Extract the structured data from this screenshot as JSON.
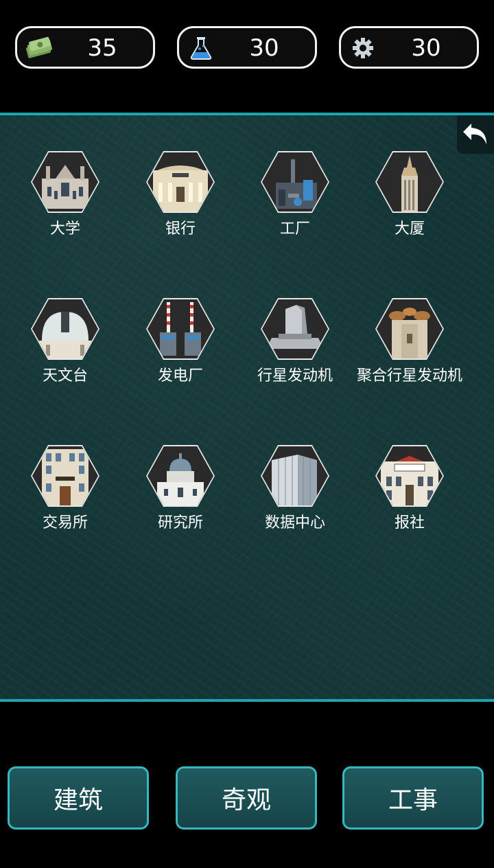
{
  "resources": {
    "money": {
      "icon": "cash-stack-icon",
      "value": "35"
    },
    "science": {
      "icon": "flask-icon",
      "value": "30"
    },
    "gear": {
      "icon": "gear-icon",
      "value": "30"
    }
  },
  "panel": {
    "back_icon": "undo-arrow-icon",
    "buildings": [
      {
        "id": "university",
        "label": "大学"
      },
      {
        "id": "bank",
        "label": "银行"
      },
      {
        "id": "factory",
        "label": "工厂"
      },
      {
        "id": "skyscraper",
        "label": "大厦"
      },
      {
        "id": "observatory",
        "label": "天文台"
      },
      {
        "id": "power-plant",
        "label": "发电厂"
      },
      {
        "id": "planet-engine",
        "label": "行星发动机"
      },
      {
        "id": "fusion-planet-engine",
        "label": "聚合行星发动机"
      },
      {
        "id": "exchange",
        "label": "交易所"
      },
      {
        "id": "institute",
        "label": "研究所"
      },
      {
        "id": "data-center",
        "label": "数据中心"
      },
      {
        "id": "newspaper",
        "label": "报社"
      }
    ]
  },
  "tabs": {
    "buildings": "建筑",
    "wonders": "奇观",
    "works": "工事"
  },
  "colors": {
    "panel_bg": "#143536",
    "accent_border": "#1aa6ae",
    "tab_border": "#37b8bf"
  }
}
